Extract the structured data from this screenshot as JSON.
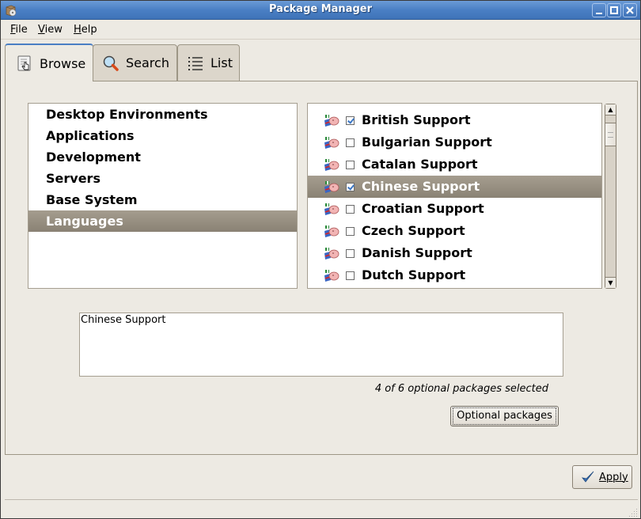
{
  "window": {
    "title": "Package Manager",
    "controls": [
      "minimize",
      "maximize",
      "close"
    ]
  },
  "menubar": {
    "items": [
      {
        "label": "File",
        "mnemonic": "F"
      },
      {
        "label": "View",
        "mnemonic": "V"
      },
      {
        "label": "Help",
        "mnemonic": "H"
      }
    ]
  },
  "tabs": [
    {
      "label": "Browse",
      "icon": "browse-hand-icon",
      "active": true
    },
    {
      "label": "Search",
      "icon": "magnifier-icon",
      "active": false
    },
    {
      "label": "List",
      "icon": "list-icon",
      "active": false
    }
  ],
  "categories": {
    "items": [
      {
        "label": "Desktop Environments",
        "selected": false
      },
      {
        "label": "Applications",
        "selected": false
      },
      {
        "label": "Development",
        "selected": false
      },
      {
        "label": "Servers",
        "selected": false
      },
      {
        "label": "Base System",
        "selected": false
      },
      {
        "label": "Languages",
        "selected": true
      }
    ]
  },
  "packages": {
    "items": [
      {
        "label": "British Support",
        "checked": true,
        "selected": false
      },
      {
        "label": "Bulgarian Support",
        "checked": false,
        "selected": false
      },
      {
        "label": "Catalan Support",
        "checked": false,
        "selected": false
      },
      {
        "label": "Chinese Support",
        "checked": true,
        "selected": true
      },
      {
        "label": "Croatian Support",
        "checked": false,
        "selected": false
      },
      {
        "label": "Czech Support",
        "checked": false,
        "selected": false
      },
      {
        "label": "Danish Support",
        "checked": false,
        "selected": false
      },
      {
        "label": "Dutch Support",
        "checked": false,
        "selected": false
      }
    ]
  },
  "description": {
    "text": "Chinese Support"
  },
  "optional": {
    "status": "4 of 6 optional packages selected",
    "button_label": "Optional packages"
  },
  "footer": {
    "apply_label": "Apply"
  },
  "colors": {
    "titlebar": "#4a7fc4",
    "selection": "#8a8274",
    "background": "#edeae3"
  }
}
